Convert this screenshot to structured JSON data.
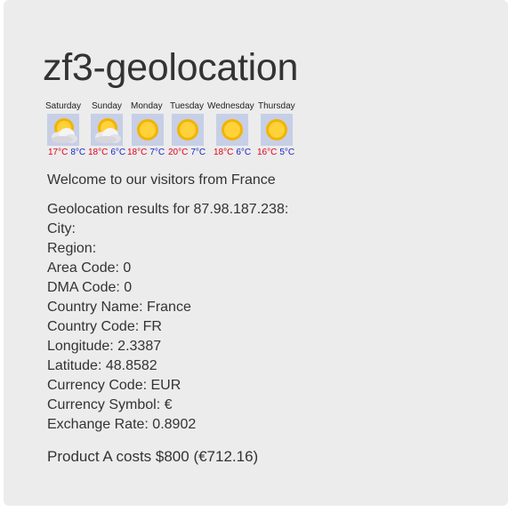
{
  "page": {
    "title": "zf3-geolocation",
    "welcome": "Welcome to our visitors from France",
    "product": "Product A costs $800 (€712.16)"
  },
  "forecast": [
    {
      "day": "Saturday",
      "high": "17°C",
      "low": "8°C",
      "icon": "partly-cloudy-icon"
    },
    {
      "day": "Sunday",
      "high": "18°C",
      "low": "6°C",
      "icon": "partly-cloudy-icon"
    },
    {
      "day": "Monday",
      "high": "18°C",
      "low": "7°C",
      "icon": "sun-icon"
    },
    {
      "day": "Tuesday",
      "high": "20°C",
      "low": "7°C",
      "icon": "sun-icon"
    },
    {
      "day": "Wednesday",
      "high": "18°C",
      "low": "6°C",
      "icon": "sun-icon"
    },
    {
      "day": "Thursday",
      "high": "16°C",
      "low": "5°C",
      "icon": "sun-icon"
    }
  ],
  "results": {
    "header": "Geolocation results for 87.98.187.238:",
    "city": "City:",
    "region": "Region:",
    "area_code": "Area Code: 0",
    "dma_code": "DMA Code: 0",
    "country_name": "Country Name: France",
    "country_code": "Country Code: FR",
    "longitude": "Longitude: 2.3387",
    "latitude": "Latitude: 48.8582",
    "currency_code": "Currency Code: EUR",
    "currency_symbol": "Currency Symbol: €",
    "exchange_rate": "Exchange Rate: 0.8902"
  },
  "colors": {
    "high_temp": "#e0001b",
    "low_temp": "#1a24c8",
    "card_bg": "#ececec",
    "icon_bg": "#c6cfe6"
  }
}
